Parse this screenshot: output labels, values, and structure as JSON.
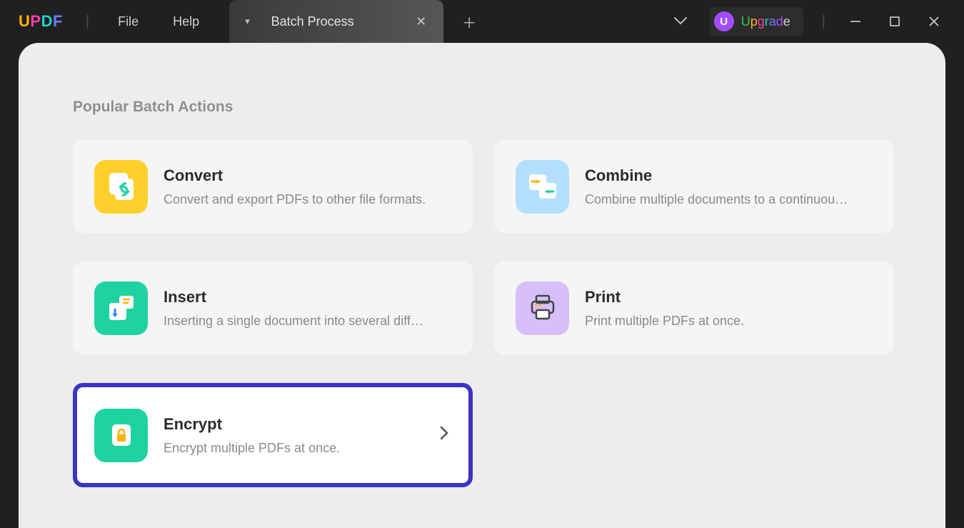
{
  "app": {
    "logo": "UPDF"
  },
  "menu": {
    "file": "File",
    "help": "Help"
  },
  "tab": {
    "title": "Batch Process"
  },
  "upgrade": {
    "avatar_letter": "U",
    "label": "Upgrade"
  },
  "section": {
    "title": "Popular Batch Actions"
  },
  "cards": {
    "convert": {
      "title": "Convert",
      "desc": "Convert and export PDFs to other file formats."
    },
    "combine": {
      "title": "Combine",
      "desc": "Combine multiple documents to a continuous PDF."
    },
    "insert": {
      "title": "Insert",
      "desc": "Inserting a single document into several different documents."
    },
    "print": {
      "title": "Print",
      "desc": "Print multiple PDFs at once."
    },
    "encrypt": {
      "title": "Encrypt",
      "desc": "Encrypt multiple PDFs at once."
    }
  }
}
